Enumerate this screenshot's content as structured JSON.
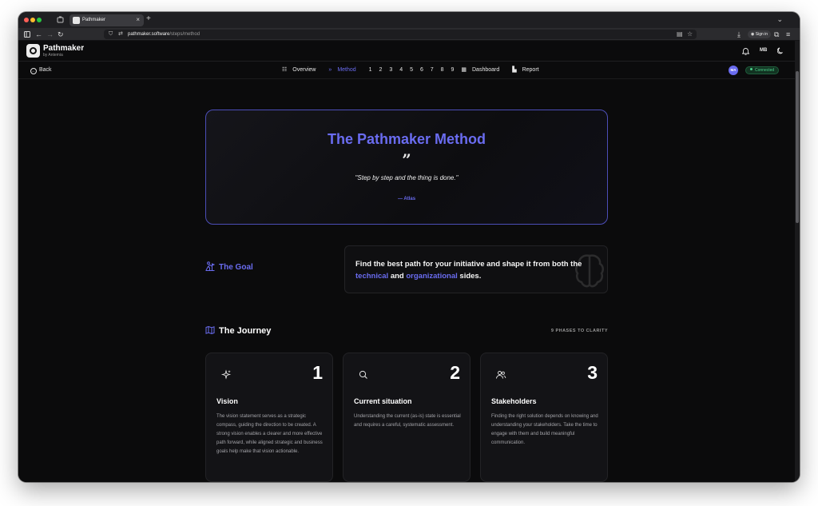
{
  "browser": {
    "tab_title": "Pathmaker",
    "url_host": "pathmaker.software",
    "url_path": "/steps/method",
    "sign_in": "Sign in"
  },
  "app": {
    "brand": "Pathmaker",
    "brand_sub": "by Antemia",
    "user_initials": "MB"
  },
  "nav": {
    "back": "Back",
    "overview": "Overview",
    "method": "Method",
    "steps": [
      "1",
      "2",
      "3",
      "4",
      "5",
      "6",
      "7",
      "8",
      "9"
    ],
    "dashboard": "Dashboard",
    "report": "Report",
    "avatar": "MA",
    "status": "Connected"
  },
  "hero": {
    "title": "The Pathmaker Method",
    "quote": "\"Step by step and the thing is done.\"",
    "attribution": "— Atlas"
  },
  "goal": {
    "label": "The Goal",
    "text_before": "Find the best path for your initiative and shape it from both the ",
    "highlight1": "technical",
    "text_mid": " and ",
    "highlight2": "organizational",
    "text_after": " sides."
  },
  "journey": {
    "title": "The Journey",
    "meta": "9 PHASES TO CLARITY",
    "cards": [
      {
        "icon": "sparkles-icon",
        "number": "1",
        "title": "Vision",
        "description": "The vision statement serves as a strategic compass, guiding the direction to be created. A strong vision enables a clearer and more effective path forward, while aligned strategic and business goals help make that vision actionable."
      },
      {
        "icon": "search-icon",
        "number": "2",
        "title": "Current situation",
        "description": "Understanding the current (as-is) state is essential and requires a careful, systematic assessment."
      },
      {
        "icon": "users-icon",
        "number": "3",
        "title": "Stakeholders",
        "description": "Finding the right solution depends on knowing and understanding your stakeholders. Take the time to engage with them and build meaningful communication."
      }
    ]
  },
  "colors": {
    "accent": "#6a6cf0",
    "background": "#0b0b0c",
    "card": "#131316",
    "status": "#4ad18a"
  }
}
